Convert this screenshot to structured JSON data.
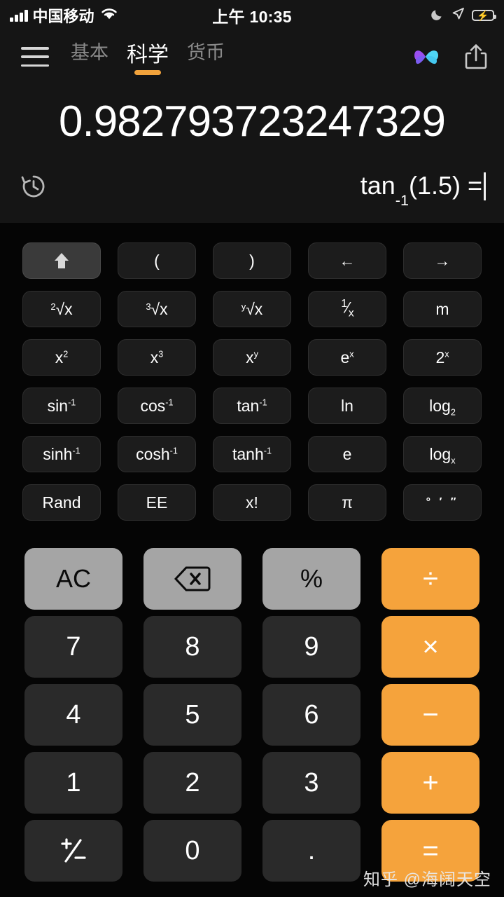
{
  "status_bar": {
    "carrier": "中国移动",
    "time": "上午 10:35",
    "signal_icon": "signal-bars-icon",
    "wifi_icon": "wifi-icon",
    "dnd_icon": "moon-icon",
    "location_icon": "location-arrow-icon",
    "battery_icon": "battery-charging-icon",
    "battery_color": "#35c759"
  },
  "nav": {
    "menu_icon": "hamburger-menu-icon",
    "tabs": [
      {
        "label": "基本",
        "active": false
      },
      {
        "label": "科学",
        "active": true
      },
      {
        "label": "货币",
        "active": false
      }
    ],
    "logo_icon": "butterfly-logo-icon",
    "share_icon": "share-icon",
    "active_underline_color": "#f2a33c"
  },
  "display": {
    "result": "0.982793723247329",
    "expression_main": "tan",
    "expression_sup": "-1",
    "expression_rest": "(1.5) =",
    "history_icon": "history-clock-icon"
  },
  "scientific_keys": [
    {
      "name": "shift-key",
      "display": "arrow-up-icon",
      "kind": "icon",
      "highlight": true
    },
    {
      "name": "open-paren-key",
      "display": "(",
      "kind": "text"
    },
    {
      "name": "close-paren-key",
      "display": ")",
      "kind": "text"
    },
    {
      "name": "cursor-left-key",
      "display": "←",
      "kind": "text"
    },
    {
      "name": "cursor-right-key",
      "display": "→",
      "kind": "text"
    },
    {
      "name": "sqrt-key",
      "display": "2|√x",
      "kind": "radical"
    },
    {
      "name": "cbrt-key",
      "display": "3|√x",
      "kind": "radical"
    },
    {
      "name": "nth-root-key",
      "display": "y|√x",
      "kind": "radical"
    },
    {
      "name": "reciprocal-key",
      "display": "1/x",
      "kind": "frac"
    },
    {
      "name": "memory-key",
      "display": "m",
      "kind": "text"
    },
    {
      "name": "square-key",
      "display": "x|2",
      "kind": "sup"
    },
    {
      "name": "cube-key",
      "display": "x|3",
      "kind": "sup"
    },
    {
      "name": "power-y-key",
      "display": "x|y",
      "kind": "sup"
    },
    {
      "name": "exp-e-key",
      "display": "e|x",
      "kind": "sup"
    },
    {
      "name": "two-power-x-key",
      "display": "2|x",
      "kind": "sup"
    },
    {
      "name": "asin-key",
      "display": "sin|-1",
      "kind": "sup"
    },
    {
      "name": "acos-key",
      "display": "cos|-1",
      "kind": "sup"
    },
    {
      "name": "atan-key",
      "display": "tan|-1",
      "kind": "sup"
    },
    {
      "name": "ln-key",
      "display": "ln",
      "kind": "text"
    },
    {
      "name": "log2-key",
      "display": "log|2",
      "kind": "sub"
    },
    {
      "name": "asinh-key",
      "display": "sinh|-1",
      "kind": "sup"
    },
    {
      "name": "acosh-key",
      "display": "cosh|-1",
      "kind": "sup"
    },
    {
      "name": "atanh-key",
      "display": "tanh|-1",
      "kind": "sup"
    },
    {
      "name": "euler-e-key",
      "display": "e",
      "kind": "text"
    },
    {
      "name": "logx-key",
      "display": "log|x",
      "kind": "sub"
    },
    {
      "name": "rand-key",
      "display": "Rand",
      "kind": "text"
    },
    {
      "name": "ee-key",
      "display": "EE",
      "kind": "text"
    },
    {
      "name": "factorial-key",
      "display": "x!",
      "kind": "text"
    },
    {
      "name": "pi-key",
      "display": "π",
      "kind": "text"
    },
    {
      "name": "dms-key",
      "display": "° ′ ″",
      "kind": "dms"
    }
  ],
  "keypad": [
    {
      "name": "all-clear-key",
      "label": "AC",
      "style": "fn"
    },
    {
      "name": "backspace-key",
      "label": "backspace-icon",
      "style": "fn",
      "icon": true
    },
    {
      "name": "percent-key",
      "label": "%",
      "style": "fn"
    },
    {
      "name": "divide-key",
      "label": "÷",
      "style": "op"
    },
    {
      "name": "digit-7-key",
      "label": "7",
      "style": "num"
    },
    {
      "name": "digit-8-key",
      "label": "8",
      "style": "num"
    },
    {
      "name": "digit-9-key",
      "label": "9",
      "style": "num"
    },
    {
      "name": "multiply-key",
      "label": "×",
      "style": "op"
    },
    {
      "name": "digit-4-key",
      "label": "4",
      "style": "num"
    },
    {
      "name": "digit-5-key",
      "label": "5",
      "style": "num"
    },
    {
      "name": "digit-6-key",
      "label": "6",
      "style": "num"
    },
    {
      "name": "minus-key",
      "label": "−",
      "style": "op"
    },
    {
      "name": "digit-1-key",
      "label": "1",
      "style": "num"
    },
    {
      "name": "digit-2-key",
      "label": "2",
      "style": "num"
    },
    {
      "name": "digit-3-key",
      "label": "3",
      "style": "num"
    },
    {
      "name": "plus-key",
      "label": "+",
      "style": "op"
    },
    {
      "name": "sign-toggle-key",
      "label": "+/-",
      "style": "num",
      "pm": true
    },
    {
      "name": "digit-0-key",
      "label": "0",
      "style": "num"
    },
    {
      "name": "decimal-point-key",
      "label": ".",
      "style": "num"
    },
    {
      "name": "equals-key",
      "label": "=",
      "style": "op"
    }
  ],
  "watermark": "知乎 @海阔天空",
  "colors": {
    "accent_orange": "#f5a33c",
    "function_grey": "#a5a5a5",
    "key_dark": "#2a2a2a",
    "display_bg": "#151515",
    "page_bg": "#050505"
  }
}
